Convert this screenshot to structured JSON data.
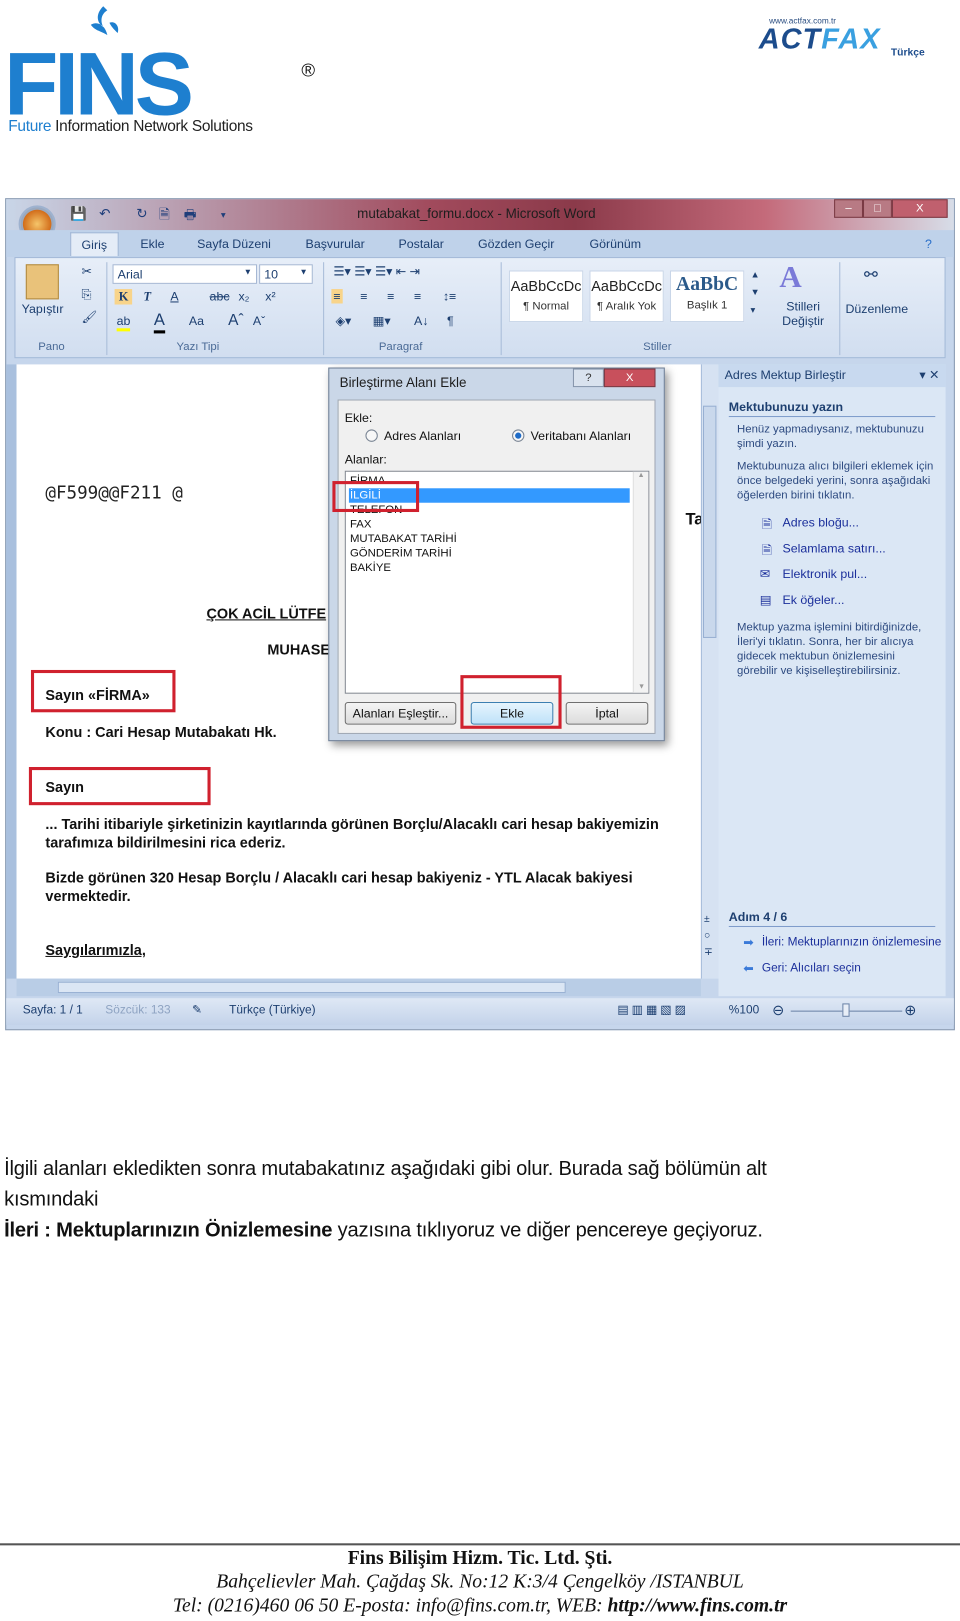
{
  "header": {
    "fins_logo": {
      "letters": "FINS",
      "registered": "®",
      "tagline_first": "Future",
      "tagline_rest": " Information Network Solutions"
    },
    "actfax_logo": {
      "url": "www.actfax.com.tr",
      "name_a": "ACT",
      "name_b": "FAX",
      "language": "Türkçe"
    }
  },
  "word": {
    "title": "mutabakat_formu.docx - Microsoft Word",
    "window_buttons": [
      "–",
      "□",
      "X"
    ],
    "tabs": [
      "Giriş",
      "Ekle",
      "Sayfa Düzeni",
      "Başvurular",
      "Postalar",
      "Gözden Geçir",
      "Görünüm"
    ],
    "ribbon": {
      "paste_label": "Yapıştır",
      "font_name": "Arial",
      "font_size": "10",
      "groups": [
        "Pano",
        "Yazı Tipi",
        "Paragraf",
        "Stiller"
      ],
      "styles": [
        {
          "preview": "AaBbCcDc",
          "name": "¶ Normal"
        },
        {
          "preview": "AaBbCcDc",
          "name": "¶ Aralık Yok"
        },
        {
          "preview": "AaBbC",
          "name": "Başlık 1"
        }
      ],
      "change_styles": "Stilleri Değiştir",
      "editing": "Düzenleme",
      "format_buttons": [
        "K",
        "T",
        "A",
        "abc",
        "x₂",
        "x²"
      ]
    },
    "document": {
      "code_line": "@F599@@F211 @",
      "urgent": "ÇOK ACİL LÜTFE",
      "dept": "MUHASE",
      "ta": "Ta",
      "salutation_field": "Sayın  «FİRMA»",
      "subject": "Konu : Cari Hesap Mutabakatı  Hk.",
      "salutation": "Sayın",
      "para1": "... Tarihi itibariyle şirketinizin kayıtlarında görünen Borçlu/Alacaklı cari hesap bakiyemizin tarafımıza bildirilmesini rica ederiz.",
      "para2": "Bizde görünen 320 Hesap Borçlu / Alacaklı cari hesap bakiyeniz  - YTL Alacak bakiyesi vermektedir.",
      "closing": "Saygılarımızla,"
    },
    "dialog": {
      "title": "Birleştirme Alanı Ekle",
      "help": "?",
      "close": "X",
      "insert_label": "Ekle:",
      "radio_address": "Adres Alanları",
      "radio_database": "Veritabanı Alanları",
      "radio_selected": "database",
      "fields_label": "Alanlar:",
      "fields": [
        "FİRMA",
        "İLGİLİ",
        "TELEFON",
        "FAX",
        "MUTABAKAT TARİHİ",
        "GÖNDERİM TARİHİ",
        "BAKİYE"
      ],
      "selected_field": "İLGİLİ",
      "match_button": "Alanları Eşleştir...",
      "insert_button": "Ekle",
      "cancel_button": "İptal"
    },
    "task_pane": {
      "title": "Adres Mektup Birleştir",
      "heading": "Mektubunuzu yazın",
      "p1": "Henüz yapmadıysanız, mektubunuzu şimdi yazın.",
      "p2": "Mektubunuza alıcı bilgileri eklemek için önce belgedeki yerini, sonra aşağıdaki öğelerden birini tıklatın.",
      "links": [
        "Adres bloğu...",
        "Selamlama satırı...",
        "Elektronik pul...",
        "Ek öğeler..."
      ],
      "p3": "Mektup yazma işlemini bitirdiğinizde, İleri'yi tıklatın. Sonra, her bir alıcıya gidecek mektubun önizlemesini görebilir ve kişiselleştirebilirsiniz.",
      "step": "Adım 4 / 6",
      "next": "İleri: Mektuplarınızın önizlemesine",
      "back": "Geri: Alıcıları seçin"
    },
    "status_bar": {
      "page": "Sayfa: 1 / 1",
      "words": "Sözcük: 133",
      "language": "Türkçe (Türkiye)",
      "zoom": "%100"
    }
  },
  "body": {
    "line1": "İlgili alanları ekledikten sonra mutabakatınız aşağıdaki gibi olur. Burada sağ bölümün alt",
    "line2": "kısmındaki",
    "line3_bold": "İleri : Mektuplarınızın Önizlemesine",
    "line3_rest": " yazısına tıklıyoruz ve diğer pencereye geçiyoruz."
  },
  "footer": {
    "company": "Fins Bilişim Hizm. Tic. Ltd. Şti.",
    "address": "Bahçelievler Mah. Çağdaş Sk. No:12 K:3/4 Çengelköy /ISTANBUL",
    "contact": "Tel: (0216)460 06 50  E-posta: info@fins.com.tr, WEB: ",
    "web": "http://www.fins.com.tr"
  }
}
